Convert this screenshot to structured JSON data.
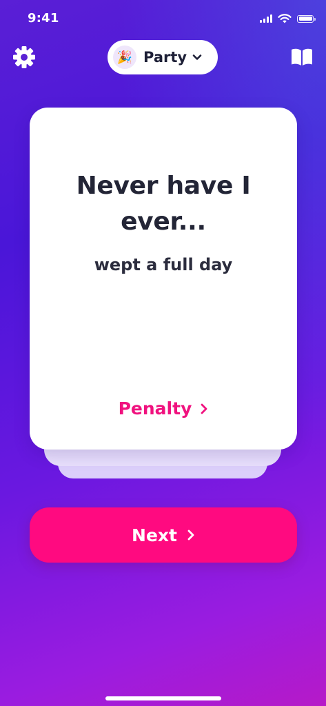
{
  "status_bar": {
    "time": "9:41"
  },
  "top_bar": {
    "settings_icon": "gear-icon",
    "mode": {
      "emoji": "🎉",
      "label": "Party",
      "dropdown_icon": "chevron-down-icon"
    },
    "rules_icon": "open-book-icon"
  },
  "card": {
    "title": "Never have I ever...",
    "prompt": "wept a full day",
    "penalty_label": "Penalty",
    "penalty_icon": "chevron-right-icon"
  },
  "next_button": {
    "label": "Next",
    "icon": "chevron-right-icon"
  },
  "colors": {
    "accent": "#ff0a80",
    "penalty_text": "#f0127f",
    "background_start": "#5a1fd6",
    "background_end": "#b61ac8",
    "card_back_1": "#e9e0fd",
    "card_back_2": "#dccffb"
  }
}
